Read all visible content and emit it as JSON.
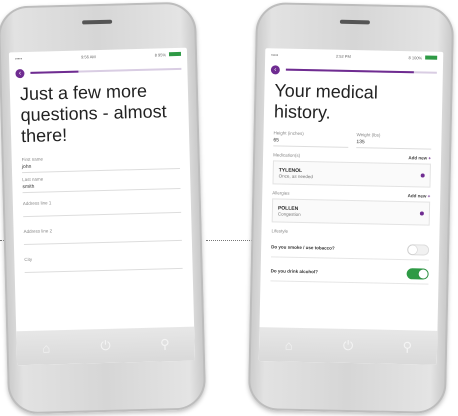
{
  "colors": {
    "accent": "#6f2c91",
    "toggle_on": "#2e9a45"
  },
  "left_screen": {
    "status": {
      "carrier": "•••••",
      "time": "9:56 AM",
      "battery": "8 95%"
    },
    "progress": 0.32,
    "back_icon": "chevron-left-icon",
    "headline": "Just a few more questions - almost there!",
    "fields": [
      {
        "label": "First name",
        "value": "john"
      },
      {
        "label": "Last name",
        "value": "smith"
      },
      {
        "label": "Address line 1",
        "value": ""
      },
      {
        "label": "Address line 2",
        "value": ""
      },
      {
        "label": "City",
        "value": ""
      }
    ],
    "nav_icons": [
      "home-icon",
      "power-icon",
      "search-icon"
    ]
  },
  "right_screen": {
    "status": {
      "carrier": "•••••",
      "time": "2:52 PM",
      "battery": "8 100%"
    },
    "progress": 0.85,
    "back_icon": "chevron-left-icon",
    "headline": "Your medical history.",
    "height": {
      "label": "Height (inches)",
      "value": "65"
    },
    "weight": {
      "label": "Weight (lbs)",
      "value": "135"
    },
    "medications": {
      "label": "Medication(s)",
      "add_label": "Add new",
      "items": [
        {
          "name": "TYLENOL",
          "detail": "Once, as needed"
        }
      ]
    },
    "allergies": {
      "label": "Allergies",
      "add_label": "Add new",
      "items": [
        {
          "name": "POLLEN",
          "detail": "Congestion"
        }
      ]
    },
    "lifestyle": {
      "label": "Lifestyle",
      "questions": [
        {
          "label": "Do you smoke / use tobacco?",
          "on": false
        },
        {
          "label": "Do you drink alcohol?",
          "on": true
        }
      ]
    },
    "nav_icons": [
      "home-icon",
      "power-icon",
      "search-icon"
    ]
  }
}
